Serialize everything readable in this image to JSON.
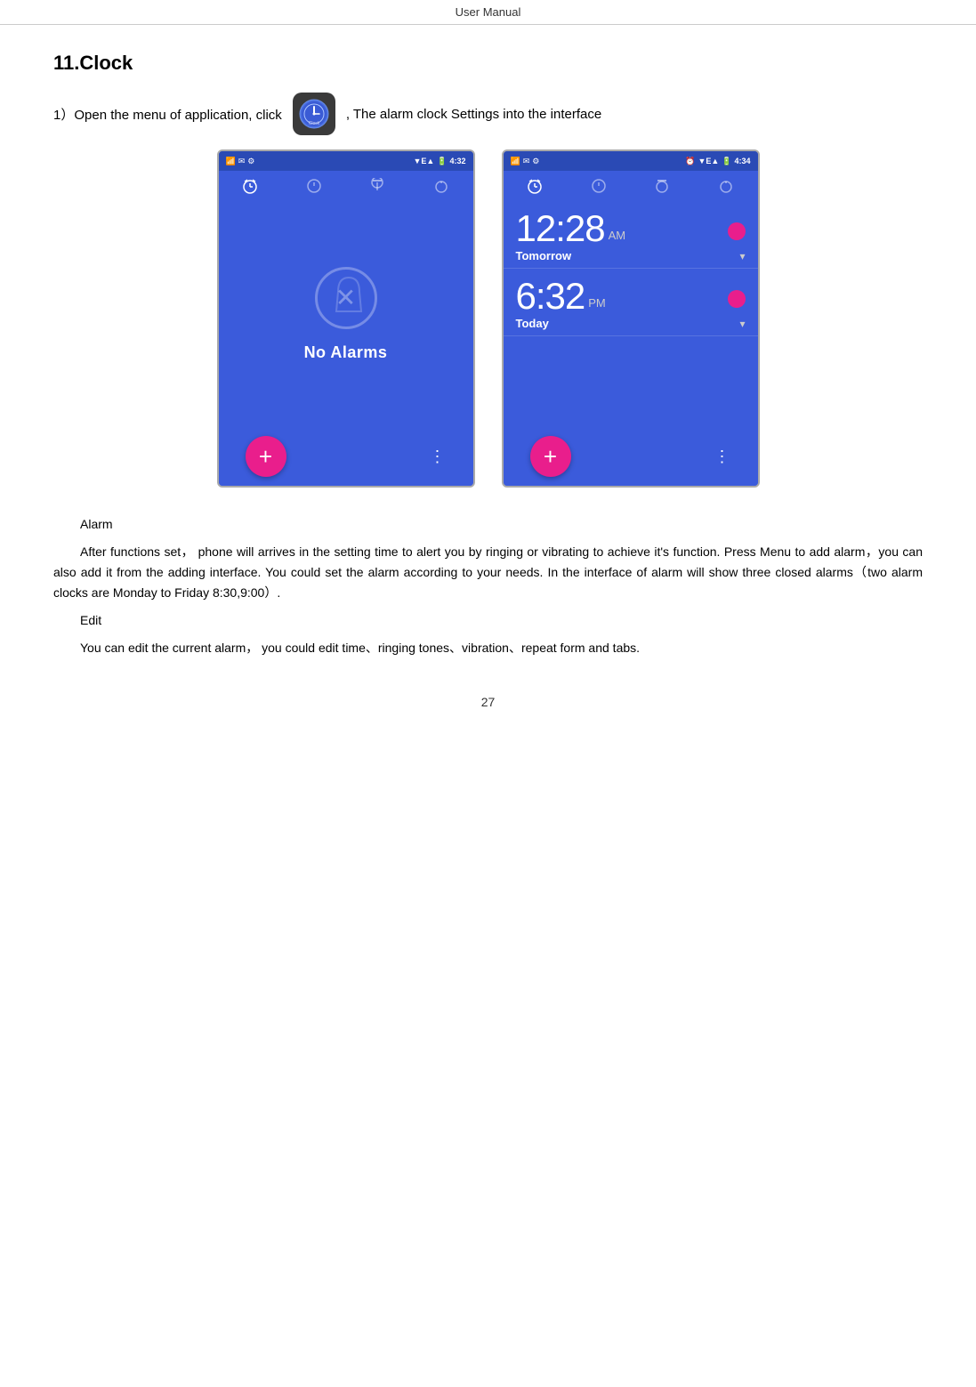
{
  "header": {
    "left": "User",
    "separator": "   ",
    "right": "Manual"
  },
  "section": {
    "title": "11.Clock",
    "intro_pre": "1）Open the menu of application, click",
    "intro_post": ", The alarm clock Settings into the interface"
  },
  "screen1": {
    "status": {
      "time": "4:32",
      "signal": "E▲",
      "battery": "■"
    },
    "no_alarms_text": "No Alarms",
    "fab_label": "+",
    "more_label": "⋮"
  },
  "screen2": {
    "status": {
      "time": "4:34",
      "signal": "E▲",
      "battery": "■"
    },
    "alarm1": {
      "time": "12:28",
      "ampm": "AM",
      "label": "Tomorrow"
    },
    "alarm2": {
      "time": "6:32",
      "ampm": "PM",
      "label": "Today"
    },
    "fab_label": "+",
    "more_label": "⋮"
  },
  "text": {
    "alarm_heading": "Alarm",
    "alarm_body": "After functions set， phone will arrives in the setting time to alert you by ringing or vibrating to achieve it's function. Press Menu to add alarm，you can also add it from the adding interface. You could set the alarm according to your needs. In the interface of alarm will show three closed alarms（two alarm clocks are Monday to Friday 8:30,9:00）.",
    "edit_heading": "Edit",
    "edit_body": "You can edit the current alarm， you could edit time、ringing tones、vibration、repeat form and tabs."
  },
  "page_number": "27"
}
